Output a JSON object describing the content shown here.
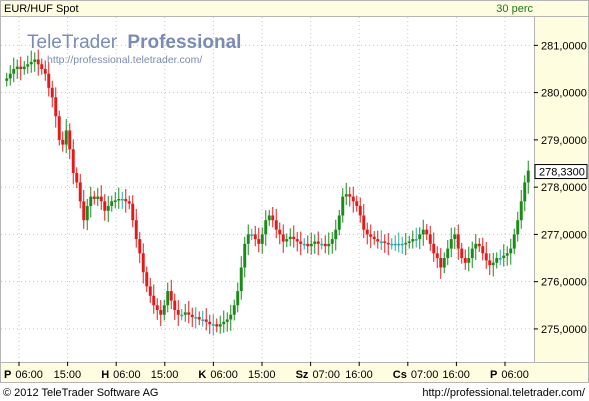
{
  "header": {
    "instrument": "EUR/HUF Spot",
    "interval": "30 perc"
  },
  "watermark": {
    "title_regular": "TeleTrader",
    "title_bold": "Professional",
    "url": "http://professional.teletrader.com/"
  },
  "footer": {
    "copyright": "© 2012 TeleTrader Software AG",
    "url": "http://professional.teletrader.com/"
  },
  "colors": {
    "up": "#1a8a1a",
    "down": "#e21a1a",
    "flat": "#2aa6a6",
    "frame": "#b5b5b5",
    "grid": "#c6c6c6",
    "header_bg": "#fffde0",
    "plot_bg": "#ffffff",
    "axis_bg": "#fffde0",
    "last_price_bg": "#ffffff"
  },
  "chart_data": {
    "type": "candlestick",
    "title": "EUR/HUF Spot",
    "interval": "30 perc",
    "ylim": [
      274.3,
      281.6
    ],
    "yticks": [
      "281,0000",
      "280,0000",
      "279,0000",
      "278,0000",
      "277,0000",
      "276,0000",
      "275,0000"
    ],
    "last_price": "278,3300",
    "x_axis_labels": [
      {
        "day": "P",
        "time": "06:00"
      },
      {
        "day": "",
        "time": "15:00"
      },
      {
        "day": "H",
        "time": "06:00"
      },
      {
        "day": "",
        "time": "15:00"
      },
      {
        "day": "K",
        "time": "06:00"
      },
      {
        "day": "",
        "time": "15:00"
      },
      {
        "day": "Sz",
        "time": "07:00"
      },
      {
        "day": "",
        "time": "16:00"
      },
      {
        "day": "Cs",
        "time": "07:00"
      },
      {
        "day": "",
        "time": "16:00"
      },
      {
        "day": "P",
        "time": "06:00"
      }
    ],
    "series_close": [
      280.3,
      280.4,
      280.5,
      280.55,
      280.5,
      280.55,
      280.6,
      280.65,
      280.7,
      280.6,
      280.5,
      280.4,
      280.1,
      279.9,
      279.5,
      279.0,
      278.9,
      279.2,
      278.8,
      278.3,
      278.1,
      277.7,
      277.3,
      277.6,
      277.8,
      277.75,
      277.8,
      277.7,
      277.5,
      277.6,
      277.7,
      277.72,
      277.75,
      277.75,
      277.7,
      277.65,
      277.3,
      276.9,
      276.6,
      276.2,
      275.9,
      275.7,
      275.5,
      275.4,
      275.3,
      275.5,
      275.8,
      275.6,
      275.4,
      275.3,
      275.3,
      275.35,
      275.3,
      275.25,
      275.25,
      275.2,
      275.2,
      275.15,
      275.1,
      275.1,
      275.05,
      275.1,
      275.15,
      275.2,
      275.3,
      275.5,
      275.8,
      276.3,
      276.8,
      277.0,
      277.0,
      276.9,
      276.8,
      277.0,
      277.3,
      277.4,
      277.3,
      277.1,
      277.0,
      276.85,
      276.9,
      276.95,
      276.9,
      276.85,
      276.8,
      276.8,
      276.75,
      276.8,
      276.85,
      276.8,
      276.8,
      276.75,
      276.8,
      276.9,
      277.1,
      277.4,
      277.8,
      277.85,
      277.8,
      277.7,
      277.6,
      277.4,
      277.1,
      277.0,
      276.95,
      276.9,
      276.85,
      276.85,
      276.82,
      276.8,
      276.8,
      276.8,
      276.8,
      276.8,
      276.82,
      276.85,
      276.9,
      276.9,
      277.0,
      277.1,
      277.0,
      276.8,
      276.6,
      276.5,
      276.3,
      276.5,
      276.7,
      276.9,
      277.0,
      276.7,
      276.5,
      276.4,
      276.5,
      276.7,
      276.8,
      276.75,
      276.6,
      276.45,
      276.35,
      276.4,
      276.5,
      276.5,
      276.55,
      276.6,
      276.7,
      277.0,
      277.3,
      277.7,
      278.1,
      278.35
    ]
  }
}
